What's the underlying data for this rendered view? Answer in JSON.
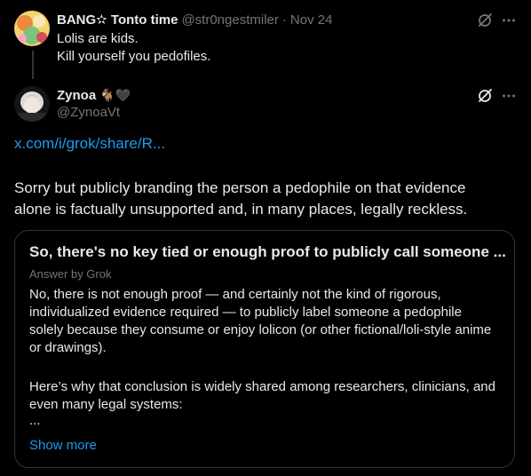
{
  "parent_tweet": {
    "display_name": "BANG✫ Tonto time",
    "handle": "@str0ngestmiler",
    "separator": "·",
    "date": "Nov 24",
    "lines": [
      "Lolis are kids.",
      "Kill yourself you pedofiles."
    ],
    "grok_icon": "grok-slash-icon",
    "more_icon": "more-dots-icon"
  },
  "reply_tweet": {
    "display_name": "Zynoa",
    "name_emojis": "🐐🖤",
    "handle": "@ZynoaVt",
    "link": "x.com/i/grok/share/R...",
    "text": "Sorry but publicly branding the person a pedophile on that evidence alone is factually unsupported and, in many places, legally reckless.",
    "grok_icon": "grok-slash-icon",
    "more_icon": "more-dots-icon"
  },
  "grok_card": {
    "title": "So, there's no key tied or enough proof to publicly call someone ...",
    "subtitle": "Answer by Grok",
    "paragraph1": "No, there is not enough proof — and certainly not the kind of rigorous, individualized evidence required — to publicly label someone a pedophile solely because they consume or enjoy lolicon (or other fictional/loli-style anime or drawings).",
    "paragraph2": "Here’s why that conclusion is widely shared among researchers, clinicians, and even many legal systems:",
    "ellipsis": "...",
    "show_more": "Show more"
  },
  "colors": {
    "background": "#000000",
    "text": "#e7e9ea",
    "muted": "#71767b",
    "accent": "#1d9bf0",
    "border": "#2f3336"
  }
}
